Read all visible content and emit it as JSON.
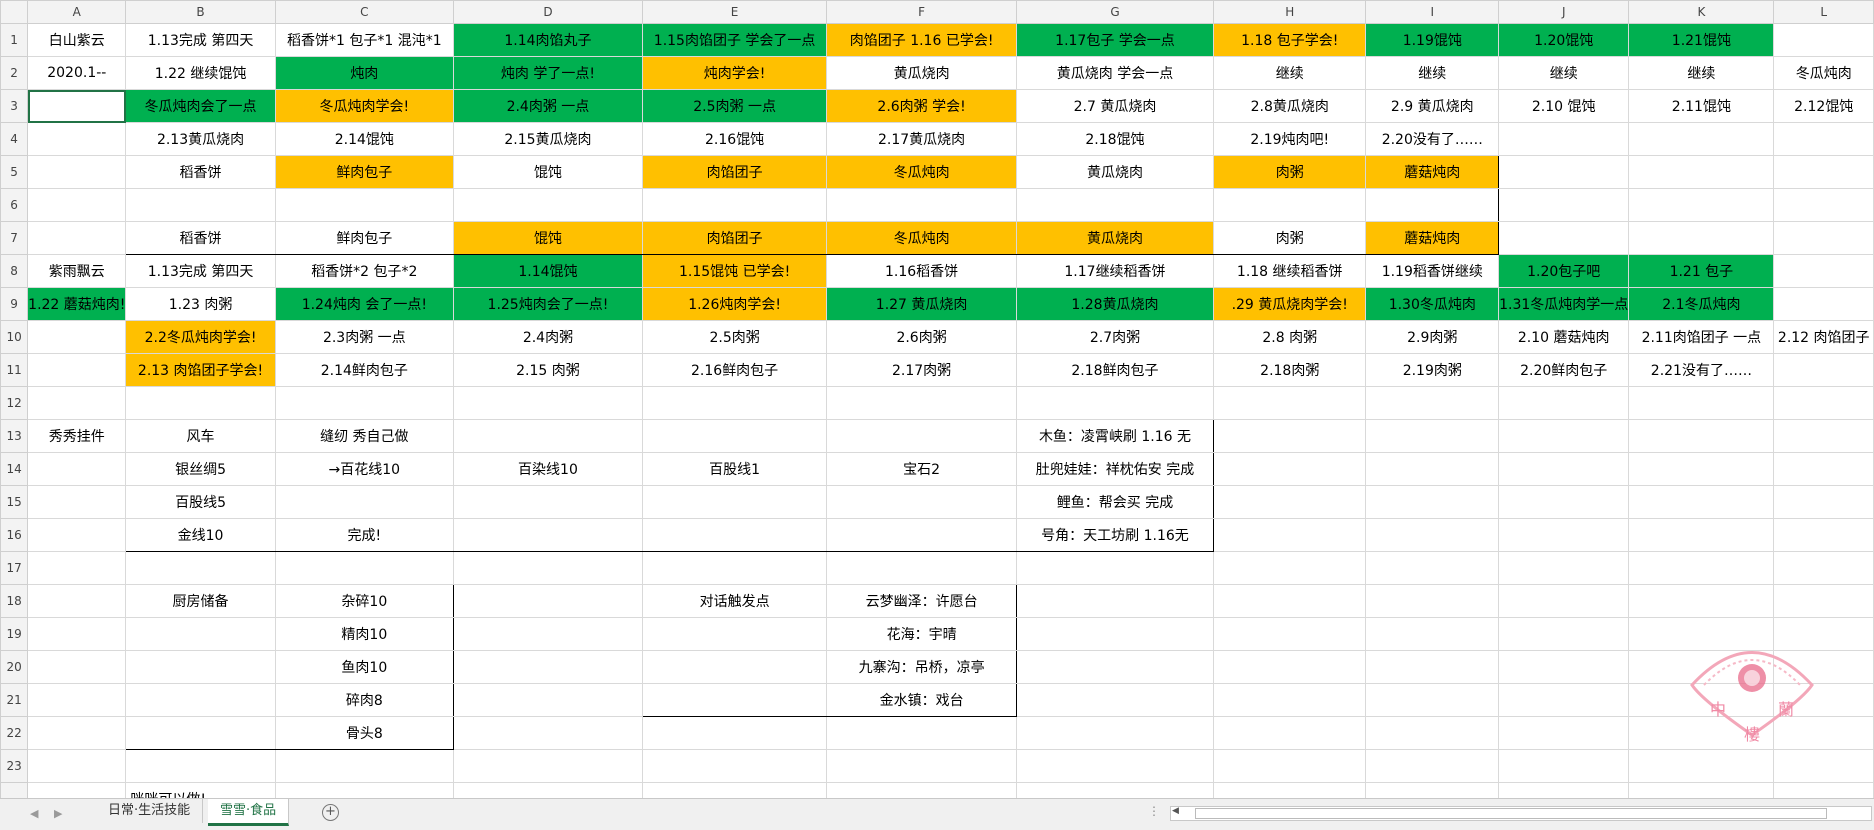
{
  "columns": [
    "A",
    "B",
    "C",
    "D",
    "E",
    "F",
    "G",
    "H",
    "I",
    "J",
    "K",
    "L"
  ],
  "rows": [
    {
      "n": "1",
      "cells": [
        {
          "t": "白山紫云"
        },
        {
          "t": "1.13完成 第四天"
        },
        {
          "t": "稻香饼*1 包子*1 混沌*1"
        },
        {
          "t": "1.14肉馅丸子",
          "c": "green"
        },
        {
          "t": "1.15肉馅团子 学会了一点",
          "c": "green"
        },
        {
          "t": "肉馅团子 1.16 已学会!",
          "c": "yellow"
        },
        {
          "t": "1.17包子 学会一点",
          "c": "green"
        },
        {
          "t": "1.18 包子学会!",
          "c": "yellow"
        },
        {
          "t": "1.19馄饨",
          "c": "green"
        },
        {
          "t": "1.20馄饨",
          "c": "green"
        },
        {
          "t": "1.21馄饨",
          "c": "green"
        },
        {
          "t": ""
        }
      ]
    },
    {
      "n": "2",
      "cells": [
        {
          "t": "2020.1--"
        },
        {
          "t": "1.22 继续馄饨"
        },
        {
          "t": "炖肉",
          "c": "green"
        },
        {
          "t": "炖肉 学了一点!",
          "c": "green"
        },
        {
          "t": "炖肉学会!",
          "c": "yellow"
        },
        {
          "t": "黄瓜烧肉"
        },
        {
          "t": "黄瓜烧肉 学会一点"
        },
        {
          "t": "继续"
        },
        {
          "t": "继续"
        },
        {
          "t": "继续"
        },
        {
          "t": "继续"
        },
        {
          "t": "冬瓜炖肉"
        }
      ]
    },
    {
      "n": "3",
      "cells": [
        {
          "t": "",
          "sel": true
        },
        {
          "t": "冬瓜炖肉会了一点",
          "c": "green"
        },
        {
          "t": "冬瓜炖肉学会!",
          "c": "yellow"
        },
        {
          "t": "2.4肉粥 一点",
          "c": "green"
        },
        {
          "t": "2.5肉粥 一点",
          "c": "green"
        },
        {
          "t": "2.6肉粥 学会!",
          "c": "yellow"
        },
        {
          "t": "2.7 黄瓜烧肉"
        },
        {
          "t": "2.8黄瓜烧肉"
        },
        {
          "t": "2.9 黄瓜烧肉"
        },
        {
          "t": "2.10 馄饨"
        },
        {
          "t": "2.11馄饨"
        },
        {
          "t": "2.12馄饨"
        }
      ]
    },
    {
      "n": "4",
      "cells": [
        {
          "t": ""
        },
        {
          "t": "2.13黄瓜烧肉"
        },
        {
          "t": "2.14馄饨"
        },
        {
          "t": "2.15黄瓜烧肉"
        },
        {
          "t": "2.16馄饨"
        },
        {
          "t": "2.17黄瓜烧肉"
        },
        {
          "t": "2.18馄饨"
        },
        {
          "t": "2.19炖肉吧!"
        },
        {
          "t": "2.20没有了……"
        },
        {
          "t": ""
        },
        {
          "t": ""
        },
        {
          "t": ""
        }
      ]
    },
    {
      "n": "5",
      "cells": [
        {
          "t": ""
        },
        {
          "t": "稻香饼"
        },
        {
          "t": "鲜肉包子",
          "c": "yellow"
        },
        {
          "t": "馄饨"
        },
        {
          "t": "肉馅团子",
          "c": "yellow"
        },
        {
          "t": "冬瓜炖肉",
          "c": "yellow"
        },
        {
          "t": "黄瓜烧肉"
        },
        {
          "t": "肉粥",
          "c": "yellow"
        },
        {
          "t": "蘑菇炖肉",
          "c": "yellow"
        },
        {
          "t": ""
        },
        {
          "t": ""
        },
        {
          "t": ""
        }
      ]
    },
    {
      "n": "6",
      "cells": [
        {
          "t": ""
        },
        {
          "t": ""
        },
        {
          "t": ""
        },
        {
          "t": ""
        },
        {
          "t": ""
        },
        {
          "t": ""
        },
        {
          "t": ""
        },
        {
          "t": ""
        },
        {
          "t": ""
        },
        {
          "t": ""
        },
        {
          "t": ""
        },
        {
          "t": ""
        }
      ]
    },
    {
      "n": "7",
      "cells": [
        {
          "t": ""
        },
        {
          "t": "稻香饼"
        },
        {
          "t": "鲜肉包子"
        },
        {
          "t": "馄饨",
          "c": "yellow"
        },
        {
          "t": "肉馅团子",
          "c": "yellow"
        },
        {
          "t": "冬瓜炖肉",
          "c": "yellow"
        },
        {
          "t": "黄瓜烧肉",
          "c": "yellow"
        },
        {
          "t": "肉粥"
        },
        {
          "t": "蘑菇炖肉",
          "c": "yellow"
        },
        {
          "t": ""
        },
        {
          "t": ""
        },
        {
          "t": ""
        }
      ]
    },
    {
      "n": "8",
      "cells": [
        {
          "t": "紫雨飘云"
        },
        {
          "t": "1.13完成 第四天"
        },
        {
          "t": "稻香饼*2 包子*2"
        },
        {
          "t": "1.14馄饨",
          "c": "green"
        },
        {
          "t": "1.15馄饨 已学会!",
          "c": "yellow"
        },
        {
          "t": "1.16稻香饼"
        },
        {
          "t": "1.17继续稻香饼"
        },
        {
          "t": "1.18 继续稻香饼"
        },
        {
          "t": "1.19稻香饼继续"
        },
        {
          "t": "1.20包子吧",
          "c": "green"
        },
        {
          "t": "1.21 包子",
          "c": "green"
        },
        {
          "t": ""
        }
      ]
    },
    {
      "n": "9",
      "cells": [
        {
          "t": "1.22 蘑菇炖肉!",
          "c": "green"
        },
        {
          "t": "1.23 肉粥"
        },
        {
          "t": "1.24炖肉 会了一点!",
          "c": "green"
        },
        {
          "t": "1.25炖肉会了一点!",
          "c": "green"
        },
        {
          "t": "1.26炖肉学会!",
          "c": "yellow"
        },
        {
          "t": "1.27 黄瓜烧肉",
          "c": "green"
        },
        {
          "t": "1.28黄瓜烧肉",
          "c": "green"
        },
        {
          "t": ".29 黄瓜烧肉学会!",
          "c": "yellow"
        },
        {
          "t": "1.30冬瓜炖肉",
          "c": "green"
        },
        {
          "t": "1.31冬瓜炖肉学一点",
          "c": "green"
        },
        {
          "t": "2.1冬瓜炖肉",
          "c": "green"
        },
        {
          "t": ""
        }
      ]
    },
    {
      "n": "10",
      "cells": [
        {
          "t": ""
        },
        {
          "t": "2.2冬瓜炖肉学会!",
          "c": "yellow"
        },
        {
          "t": "2.3肉粥 一点"
        },
        {
          "t": "2.4肉粥"
        },
        {
          "t": "2.5肉粥"
        },
        {
          "t": "2.6肉粥"
        },
        {
          "t": "2.7肉粥"
        },
        {
          "t": "2.8 肉粥"
        },
        {
          "t": "2.9肉粥"
        },
        {
          "t": "2.10 蘑菇炖肉"
        },
        {
          "t": "2.11肉馅团子 一点"
        },
        {
          "t": "2.12 肉馅团子"
        }
      ]
    },
    {
      "n": "11",
      "cells": [
        {
          "t": ""
        },
        {
          "t": "2.13 肉馅团子学会!",
          "c": "yellow"
        },
        {
          "t": "2.14鲜肉包子"
        },
        {
          "t": "2.15 肉粥"
        },
        {
          "t": "2.16鲜肉包子"
        },
        {
          "t": "2.17肉粥"
        },
        {
          "t": "2.18鲜肉包子"
        },
        {
          "t": "2.18肉粥"
        },
        {
          "t": "2.19肉粥"
        },
        {
          "t": "2.20鲜肉包子"
        },
        {
          "t": "2.21没有了……"
        },
        {
          "t": ""
        }
      ]
    },
    {
      "n": "12",
      "cells": [
        {
          "t": ""
        },
        {
          "t": ""
        },
        {
          "t": ""
        },
        {
          "t": ""
        },
        {
          "t": ""
        },
        {
          "t": ""
        },
        {
          "t": ""
        },
        {
          "t": ""
        },
        {
          "t": ""
        },
        {
          "t": ""
        },
        {
          "t": ""
        },
        {
          "t": ""
        }
      ]
    },
    {
      "n": "13",
      "cells": [
        {
          "t": "秀秀挂件"
        },
        {
          "t": "风车"
        },
        {
          "t": "缝纫 秀自己做"
        },
        {
          "t": ""
        },
        {
          "t": ""
        },
        {
          "t": ""
        },
        {
          "t": "木鱼：凌霄峡刷 1.16 无"
        },
        {
          "t": ""
        },
        {
          "t": ""
        },
        {
          "t": ""
        },
        {
          "t": ""
        },
        {
          "t": ""
        }
      ]
    },
    {
      "n": "14",
      "cells": [
        {
          "t": ""
        },
        {
          "t": "银丝绸5"
        },
        {
          "t": "→百花线10"
        },
        {
          "t": "百染线10"
        },
        {
          "t": "百股线1"
        },
        {
          "t": "宝石2"
        },
        {
          "t": "肚兜娃娃：祥枕佑安 完成"
        },
        {
          "t": ""
        },
        {
          "t": ""
        },
        {
          "t": ""
        },
        {
          "t": ""
        },
        {
          "t": ""
        }
      ]
    },
    {
      "n": "15",
      "cells": [
        {
          "t": ""
        },
        {
          "t": "百股线5"
        },
        {
          "t": ""
        },
        {
          "t": ""
        },
        {
          "t": ""
        },
        {
          "t": ""
        },
        {
          "t": "鲤鱼：帮会买 完成"
        },
        {
          "t": ""
        },
        {
          "t": ""
        },
        {
          "t": ""
        },
        {
          "t": ""
        },
        {
          "t": ""
        }
      ]
    },
    {
      "n": "16",
      "cells": [
        {
          "t": ""
        },
        {
          "t": "金线10"
        },
        {
          "t": "完成!"
        },
        {
          "t": ""
        },
        {
          "t": ""
        },
        {
          "t": ""
        },
        {
          "t": "号角：天工坊刷 1.16无"
        },
        {
          "t": ""
        },
        {
          "t": ""
        },
        {
          "t": ""
        },
        {
          "t": ""
        },
        {
          "t": ""
        }
      ]
    },
    {
      "n": "17",
      "cells": [
        {
          "t": ""
        },
        {
          "t": ""
        },
        {
          "t": ""
        },
        {
          "t": ""
        },
        {
          "t": ""
        },
        {
          "t": ""
        },
        {
          "t": ""
        },
        {
          "t": ""
        },
        {
          "t": ""
        },
        {
          "t": ""
        },
        {
          "t": ""
        },
        {
          "t": ""
        }
      ]
    },
    {
      "n": "18",
      "cells": [
        {
          "t": ""
        },
        {
          "t": "厨房储备"
        },
        {
          "t": "杂碎10"
        },
        {
          "t": ""
        },
        {
          "t": "对话触发点"
        },
        {
          "t": "云梦幽泽：许愿台"
        },
        {
          "t": ""
        },
        {
          "t": ""
        },
        {
          "t": ""
        },
        {
          "t": ""
        },
        {
          "t": ""
        },
        {
          "t": ""
        }
      ]
    },
    {
      "n": "19",
      "cells": [
        {
          "t": ""
        },
        {
          "t": ""
        },
        {
          "t": "精肉10"
        },
        {
          "t": ""
        },
        {
          "t": ""
        },
        {
          "t": "花海：宇晴"
        },
        {
          "t": ""
        },
        {
          "t": ""
        },
        {
          "t": ""
        },
        {
          "t": ""
        },
        {
          "t": ""
        },
        {
          "t": ""
        }
      ]
    },
    {
      "n": "20",
      "cells": [
        {
          "t": ""
        },
        {
          "t": ""
        },
        {
          "t": "鱼肉10"
        },
        {
          "t": ""
        },
        {
          "t": ""
        },
        {
          "t": "九寨沟：吊桥，凉亭"
        },
        {
          "t": ""
        },
        {
          "t": ""
        },
        {
          "t": ""
        },
        {
          "t": ""
        },
        {
          "t": ""
        },
        {
          "t": ""
        }
      ]
    },
    {
      "n": "21",
      "cells": [
        {
          "t": ""
        },
        {
          "t": ""
        },
        {
          "t": "碎肉8"
        },
        {
          "t": ""
        },
        {
          "t": ""
        },
        {
          "t": "金水镇：戏台"
        },
        {
          "t": ""
        },
        {
          "t": ""
        },
        {
          "t": ""
        },
        {
          "t": ""
        },
        {
          "t": ""
        },
        {
          "t": ""
        }
      ]
    },
    {
      "n": "22",
      "cells": [
        {
          "t": ""
        },
        {
          "t": ""
        },
        {
          "t": "骨头8"
        },
        {
          "t": ""
        },
        {
          "t": ""
        },
        {
          "t": ""
        },
        {
          "t": ""
        },
        {
          "t": ""
        },
        {
          "t": ""
        },
        {
          "t": ""
        },
        {
          "t": ""
        },
        {
          "t": ""
        }
      ]
    },
    {
      "n": "23",
      "cells": [
        {
          "t": ""
        },
        {
          "t": ""
        },
        {
          "t": ""
        },
        {
          "t": ""
        },
        {
          "t": ""
        },
        {
          "t": ""
        },
        {
          "t": ""
        },
        {
          "t": ""
        },
        {
          "t": ""
        },
        {
          "t": ""
        },
        {
          "t": ""
        },
        {
          "t": ""
        }
      ]
    },
    {
      "n": "",
      "cells": [
        {
          "t": ""
        },
        {
          "t": "咪咪可以做!"
        },
        {
          "t": ""
        },
        {
          "t": ""
        },
        {
          "t": ""
        },
        {
          "t": ""
        },
        {
          "t": ""
        },
        {
          "t": ""
        },
        {
          "t": ""
        },
        {
          "t": ""
        },
        {
          "t": ""
        },
        {
          "t": ""
        }
      ]
    }
  ],
  "sheet_tabs": [
    "日常·生活技能",
    "雪雪·食品"
  ],
  "active_tab": "雪雪·食品",
  "add_sheet_label": "+",
  "scroll_dots": "⋮",
  "colors": {
    "green": "#00b050",
    "yellow": "#ffc000",
    "selection": "#217346"
  },
  "watermark": {
    "text_left": "中",
    "text_right": "蘭",
    "text_bottom": "樓"
  }
}
